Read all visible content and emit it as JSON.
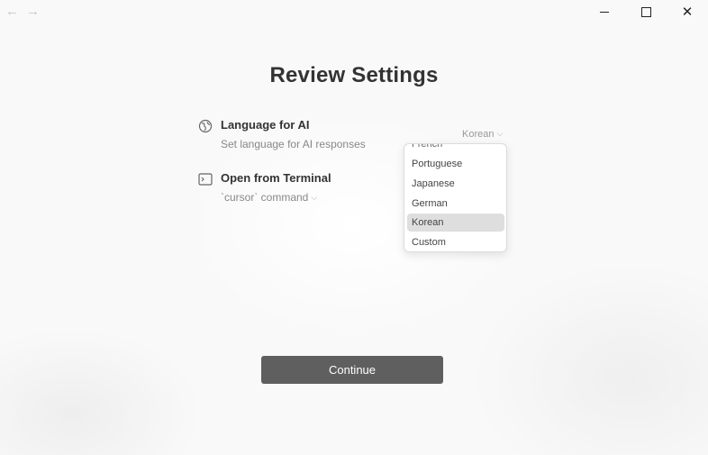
{
  "nav": {
    "back_icon": "arrow-left-icon",
    "forward_icon": "arrow-right-icon"
  },
  "window_controls": {
    "minimize": "minimize-icon",
    "maximize": "maximize-icon",
    "close": "close-icon"
  },
  "page_title": "Review Settings",
  "settings": {
    "language": {
      "icon": "globe-icon",
      "label": "Language for AI",
      "description": "Set language for AI responses",
      "selected_value": "Korean",
      "options": [
        "French",
        "Portuguese",
        "Japanese",
        "German",
        "Korean",
        "Custom"
      ]
    },
    "terminal": {
      "icon": "terminal-icon",
      "label": "Open from Terminal",
      "command": "`cursor` command"
    }
  },
  "continue_label": "Continue",
  "colors": {
    "button_bg": "#5f5f5f",
    "selected_option_bg": "#dedede"
  }
}
